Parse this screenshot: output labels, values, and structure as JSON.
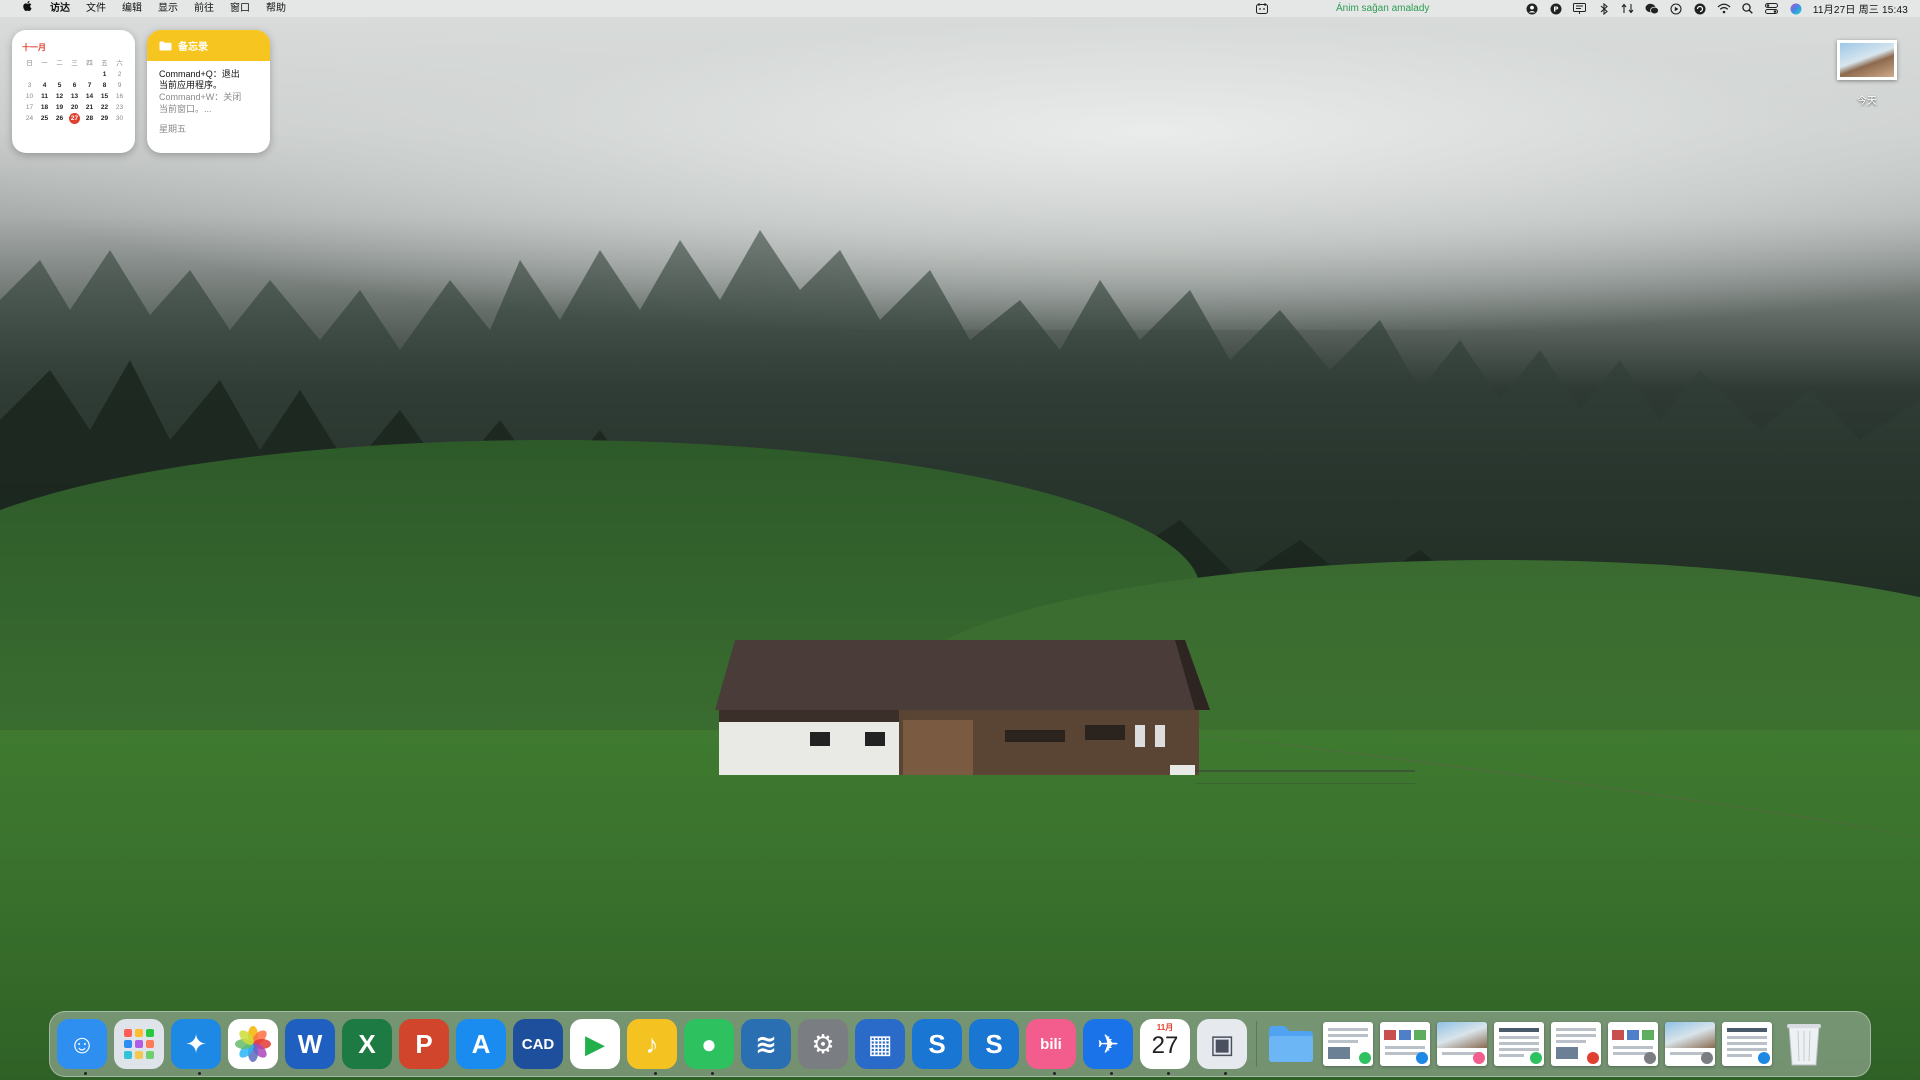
{
  "menubar": {
    "apple": "apple-logo",
    "items": [
      "访达",
      "文件",
      "编辑",
      "显示",
      "前往",
      "窗口",
      "帮助"
    ],
    "status_text": "Ánim sağan amalady",
    "clock": "11月27日 周三 15:43",
    "tray_icons": [
      "user-icon",
      "p-icon",
      "screen-icon",
      "bluetooth-icon",
      "network-activity-icon",
      "wechat-icon",
      "play-circle-icon",
      "dial-icon",
      "wifi-icon",
      "search-icon",
      "control-center-icon",
      "siri-icon"
    ]
  },
  "calendar_widget": {
    "month": "十一月",
    "weekdays": [
      "日",
      "一",
      "二",
      "三",
      "四",
      "五",
      "六"
    ],
    "weeks": [
      [
        "",
        "",
        "",
        "",
        "",
        "1",
        "2"
      ],
      [
        "3",
        "4",
        "5",
        "6",
        "7",
        "8",
        "9"
      ],
      [
        "10",
        "11",
        "12",
        "13",
        "14",
        "15",
        "16"
      ],
      [
        "17",
        "18",
        "19",
        "20",
        "21",
        "22",
        "23"
      ],
      [
        "24",
        "25",
        "26",
        "27",
        "28",
        "29",
        "30"
      ]
    ],
    "today": "27"
  },
  "notes_widget": {
    "title": "备忘录",
    "line1": "Command+Q：退出",
    "line2": "当前应用程序。",
    "line3": "Command+W：关闭",
    "line4": "当前窗口。...",
    "day": "星期五"
  },
  "desktop": {
    "item_label": "今天"
  },
  "dock": {
    "apps": [
      {
        "name": "finder",
        "glyph": "☺",
        "bg": "#2e8ff0",
        "running": true
      },
      {
        "name": "launchpad",
        "glyph": "",
        "bg": "#dfe3ea",
        "running": false
      },
      {
        "name": "safari",
        "glyph": "✦",
        "bg": "#1e88e5",
        "running": true
      },
      {
        "name": "photos",
        "glyph": "✿",
        "bg": "#ffffff",
        "running": false
      },
      {
        "name": "word",
        "glyph": "W",
        "bg": "#1f5fbf",
        "running": false
      },
      {
        "name": "excel",
        "glyph": "X",
        "bg": "#1e7a43",
        "running": false
      },
      {
        "name": "powerpoint",
        "glyph": "P",
        "bg": "#d0452b",
        "running": false
      },
      {
        "name": "app-store",
        "glyph": "A",
        "bg": "#1a8cf0",
        "running": false
      },
      {
        "name": "cad",
        "glyph": "CAD",
        "bg": "#1e4f9c",
        "running": false
      },
      {
        "name": "infuse-player",
        "glyph": "▶",
        "bg": "#ffffff",
        "running": false
      },
      {
        "name": "music-app",
        "glyph": "♪",
        "bg": "#f5c321",
        "running": true
      },
      {
        "name": "wechat",
        "glyph": "●",
        "bg": "#2dc160",
        "running": true
      },
      {
        "name": "layers-app",
        "glyph": "≋",
        "bg": "#2b6fb3",
        "running": false
      },
      {
        "name": "system-settings",
        "glyph": "⚙",
        "bg": "#7a7d82",
        "running": false
      },
      {
        "name": "calculator-app",
        "glyph": "▦",
        "bg": "#2a6bc9",
        "running": false
      },
      {
        "name": "s-app-1",
        "glyph": "S",
        "bg": "#1976d2",
        "running": false
      },
      {
        "name": "s-app-2",
        "glyph": "S",
        "bg": "#1976d2",
        "running": false
      },
      {
        "name": "bilibili",
        "glyph": "bili",
        "bg": "#f25d8e",
        "running": true
      },
      {
        "name": "navigation-app",
        "glyph": "✈",
        "bg": "#1a73e8",
        "running": true
      },
      {
        "name": "calendar",
        "glyph": "27",
        "bg": "#ffffff",
        "month": "11月",
        "running": true
      },
      {
        "name": "preview",
        "glyph": "▣",
        "bg": "#e6e9ee",
        "running": true
      }
    ],
    "folders": [
      {
        "name": "downloads-folder",
        "bg": "#4fa3f0"
      }
    ],
    "recent_docs": [
      {
        "name": "recent-doc-1",
        "badge": "#2dc160"
      },
      {
        "name": "recent-doc-2",
        "badge": "#1e88e5"
      },
      {
        "name": "recent-doc-3",
        "badge": "#f25d8e"
      },
      {
        "name": "recent-doc-4",
        "badge": "#2dc160"
      },
      {
        "name": "recent-doc-5",
        "badge": "#e0402f"
      },
      {
        "name": "recent-doc-6",
        "badge": "#7a7d82"
      },
      {
        "name": "recent-doc-7",
        "badge": "#7a7d82"
      },
      {
        "name": "recent-doc-8",
        "badge": "#1e88e5"
      }
    ],
    "trash": {
      "name": "trash-icon"
    }
  },
  "colors": {
    "accent_red": "#e0402f",
    "notes_yellow": "#f7c520",
    "status_green": "#2e9b55"
  }
}
